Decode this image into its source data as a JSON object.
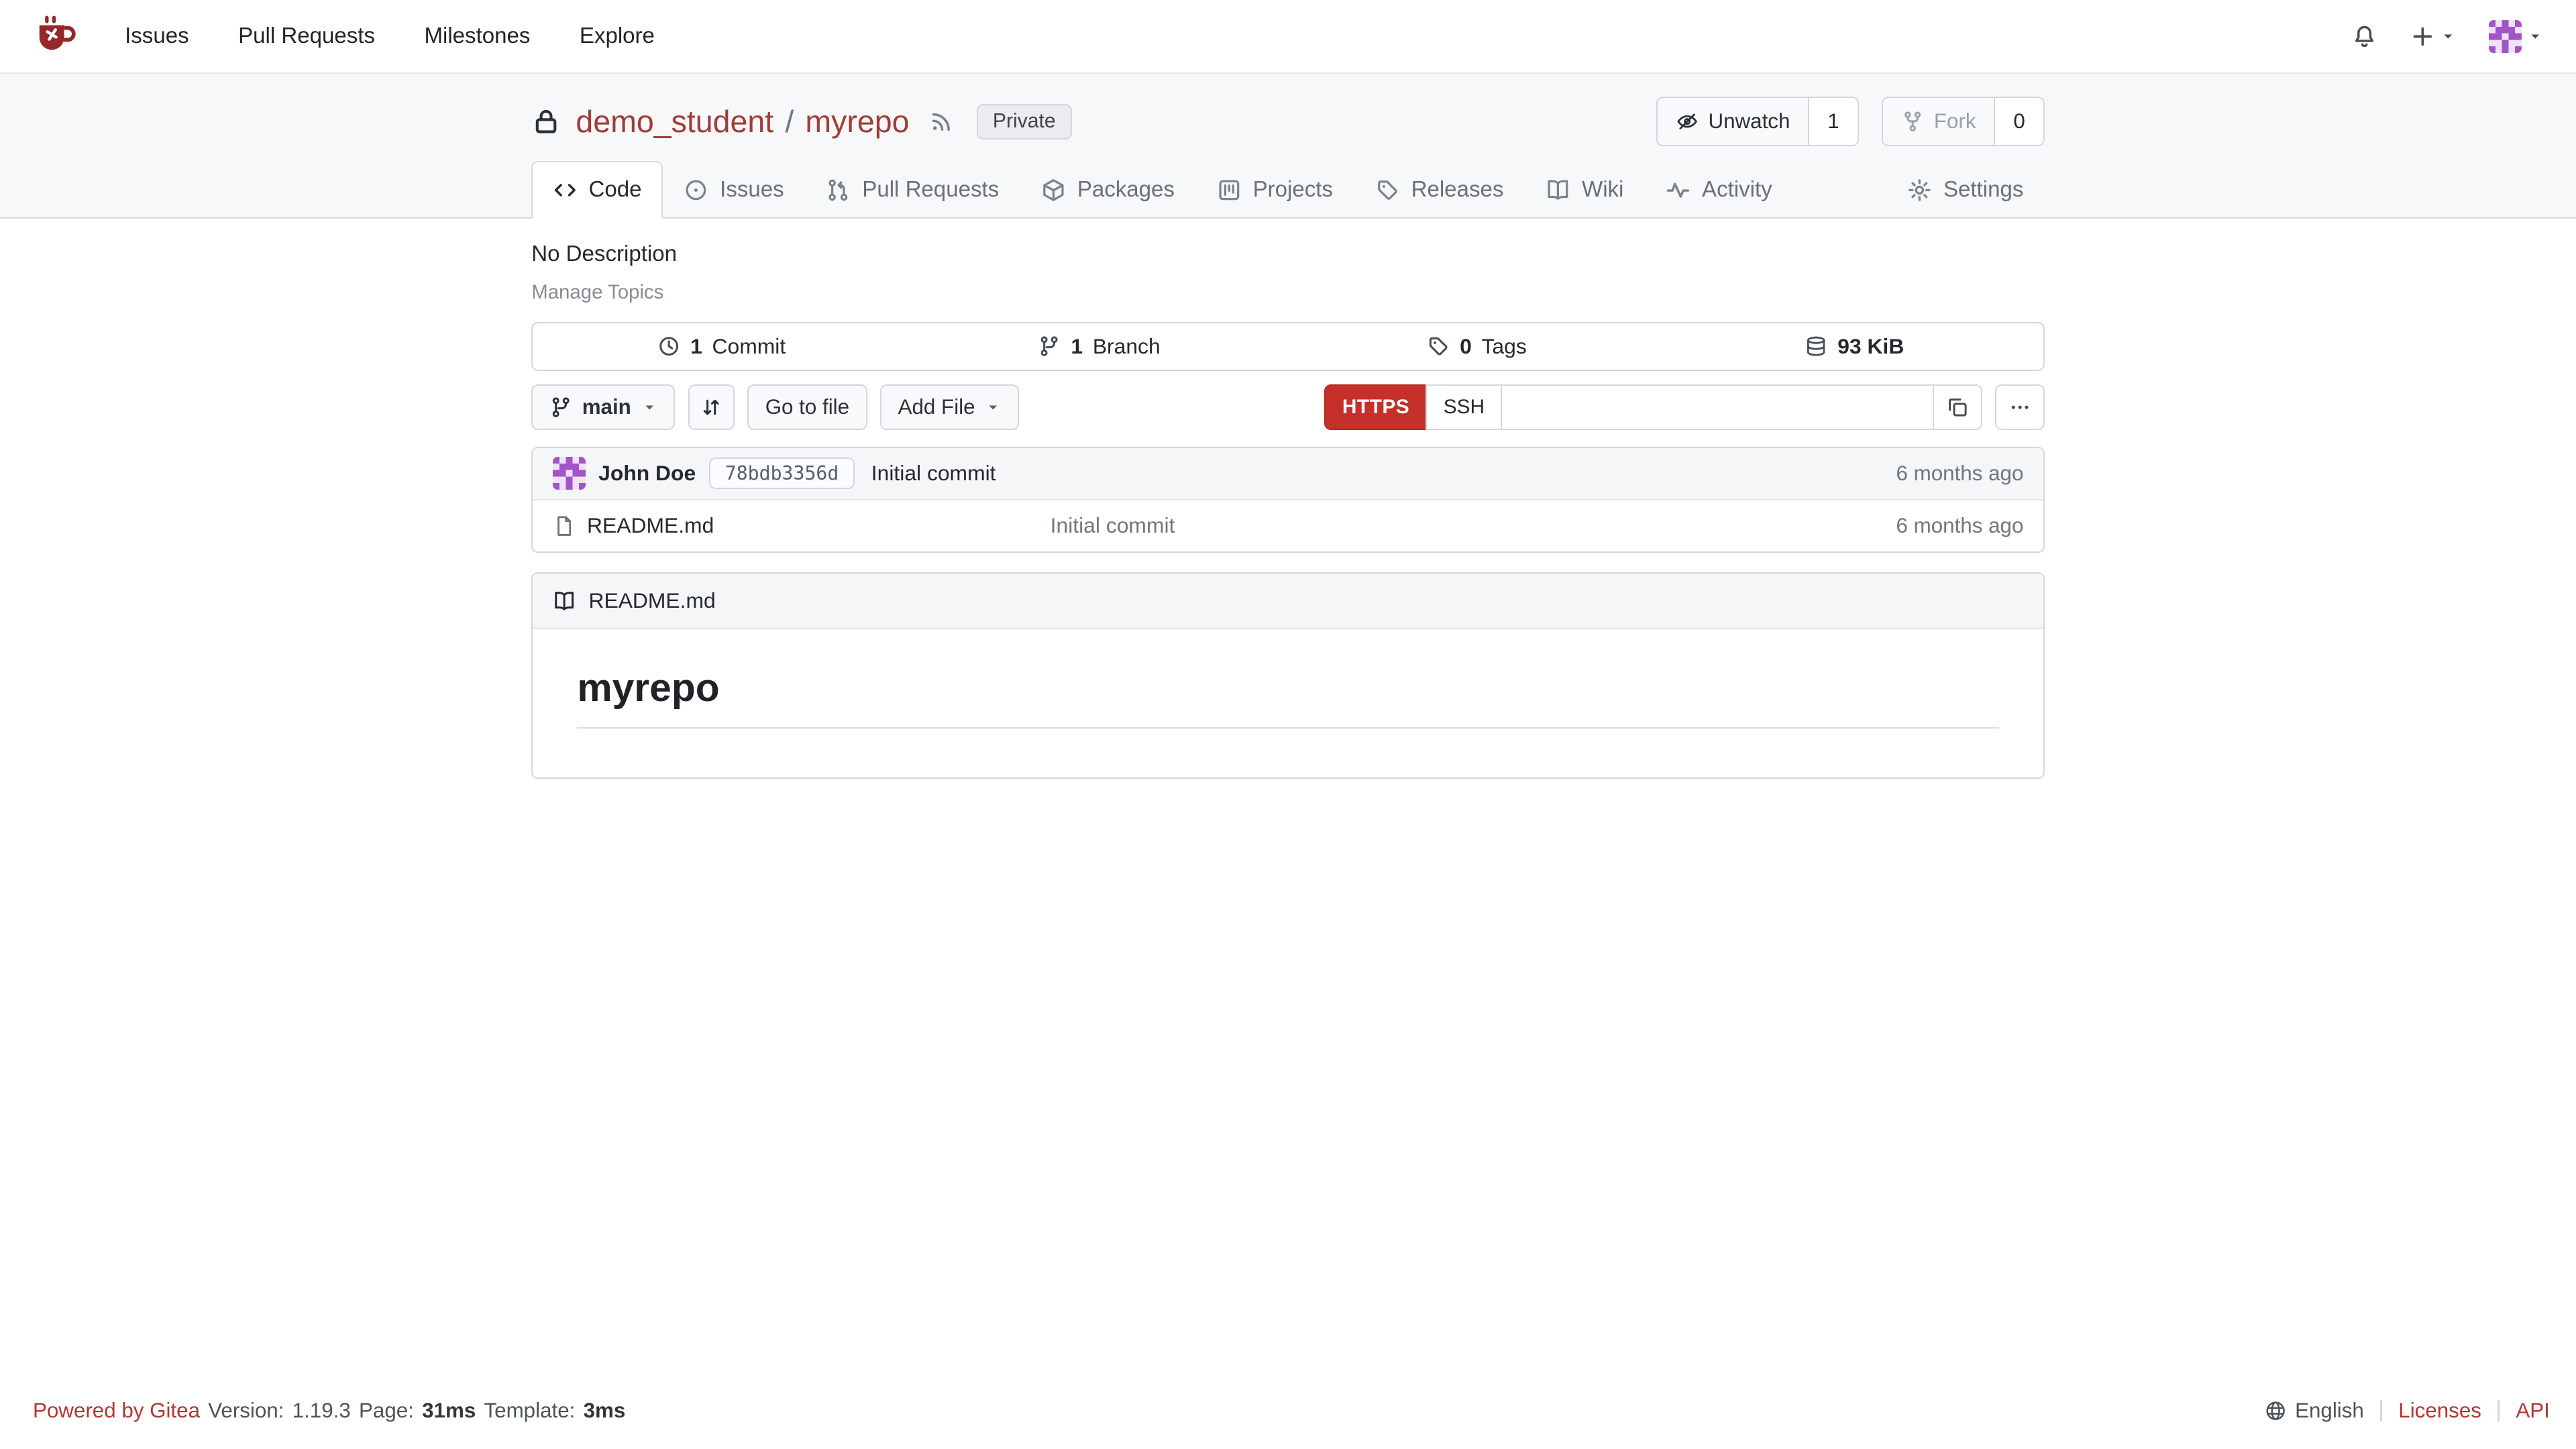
{
  "colors": {
    "accent_link_red": "#a13c38",
    "button_red": "#c5302a",
    "footer_link_red": "#b23730",
    "header_band_bg": "#f7f8fa",
    "panel_header_bg": "#f4f6f8",
    "border": "#d4d7db"
  },
  "navbar": {
    "links": [
      {
        "label": "Issues"
      },
      {
        "label": "Pull Requests"
      },
      {
        "label": "Milestones"
      },
      {
        "label": "Explore"
      }
    ],
    "icons": [
      "gitea-logo",
      "bell-icon",
      "plus-icon",
      "caret-down-icon",
      "avatar"
    ]
  },
  "repo": {
    "owner": "demo_student",
    "path_separator": "/",
    "name": "myrepo",
    "badge": "Private",
    "unwatch": {
      "label": "Unwatch",
      "count": "1"
    },
    "fork": {
      "label": "Fork",
      "count": "0"
    }
  },
  "tabs": [
    {
      "label": "Code",
      "icon": "code-icon",
      "active": true
    },
    {
      "label": "Issues",
      "icon": "issue-opened-icon"
    },
    {
      "label": "Pull Requests",
      "icon": "git-pull-request-icon"
    },
    {
      "label": "Packages",
      "icon": "package-icon"
    },
    {
      "label": "Projects",
      "icon": "project-icon"
    },
    {
      "label": "Releases",
      "icon": "tag-icon"
    },
    {
      "label": "Wiki",
      "icon": "book-icon"
    },
    {
      "label": "Activity",
      "icon": "pulse-icon"
    }
  ],
  "settings_tab": {
    "label": "Settings",
    "icon": "gear-icon"
  },
  "overview": {
    "description": "No Description",
    "manage_topics": "Manage Topics",
    "stats": [
      {
        "value": "1",
        "label": "Commit",
        "icon": "clock-icon"
      },
      {
        "value": "1",
        "label": "Branch",
        "icon": "git-branch-icon"
      },
      {
        "value": "0",
        "label": "Tags",
        "icon": "tag-icon"
      },
      {
        "value": "93 KiB",
        "label": "",
        "icon": "database-icon"
      }
    ]
  },
  "controls": {
    "branch_button": "main",
    "go_to_file": "Go to file",
    "add_file": "Add File",
    "https": "HTTPS",
    "ssh": "SSH",
    "clone_url": ""
  },
  "commit": {
    "author": "John Doe",
    "hash": "78bdb3356d",
    "message": "Initial commit",
    "time": "6 months ago"
  },
  "files": [
    {
      "name": "README.md",
      "icon": "file-icon",
      "message": "Initial commit",
      "time": "6 months ago"
    }
  ],
  "readme": {
    "header": "README.md",
    "heading": "myrepo"
  },
  "footer": {
    "powered": "Powered by Gitea",
    "version_label": "Version:",
    "version_value": "1.19.3",
    "page_label": "Page:",
    "page_value": "31ms",
    "template_label": "Template:",
    "template_value": "3ms",
    "language": "English",
    "licenses": "Licenses",
    "api": "API"
  }
}
